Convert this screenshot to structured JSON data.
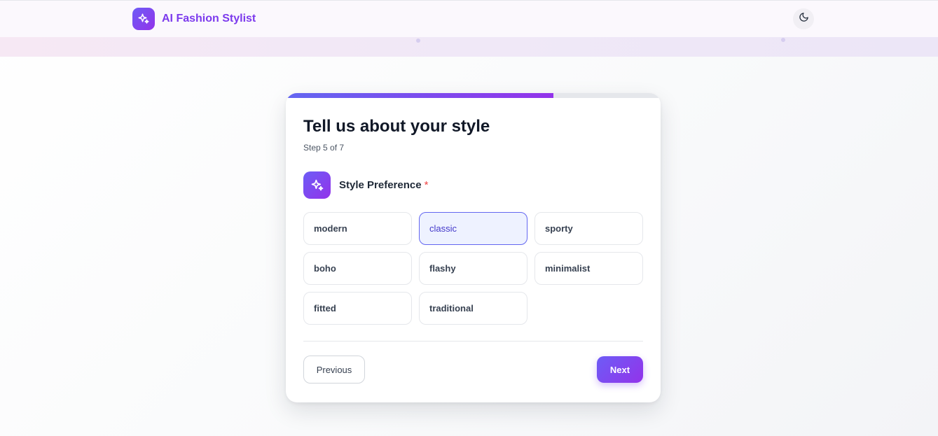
{
  "app": {
    "name": "AI Fashion Stylist",
    "logo_icon": "sparkles-icon",
    "theme_toggle_icon": "moon-icon"
  },
  "colors": {
    "accent_start": "#6d5cf6",
    "accent_end": "#9333ea",
    "selected_border": "#6366f1",
    "required": "#ef4444"
  },
  "form": {
    "title": "Tell us about your style",
    "step": "Step 5 of 7",
    "progress": 0.714,
    "question": {
      "label": "Style Preference",
      "required_mark": "*",
      "icon": "sparkles-icon",
      "options": [
        {
          "label": "modern",
          "selected": false
        },
        {
          "label": "classic",
          "selected": true
        },
        {
          "label": "sporty",
          "selected": false
        },
        {
          "label": "boho",
          "selected": false
        },
        {
          "label": "flashy",
          "selected": false
        },
        {
          "label": "minimalist",
          "selected": false
        },
        {
          "label": "fitted",
          "selected": false
        },
        {
          "label": "traditional",
          "selected": false
        }
      ]
    },
    "previous_label": "Previous",
    "next_label": "Next"
  }
}
